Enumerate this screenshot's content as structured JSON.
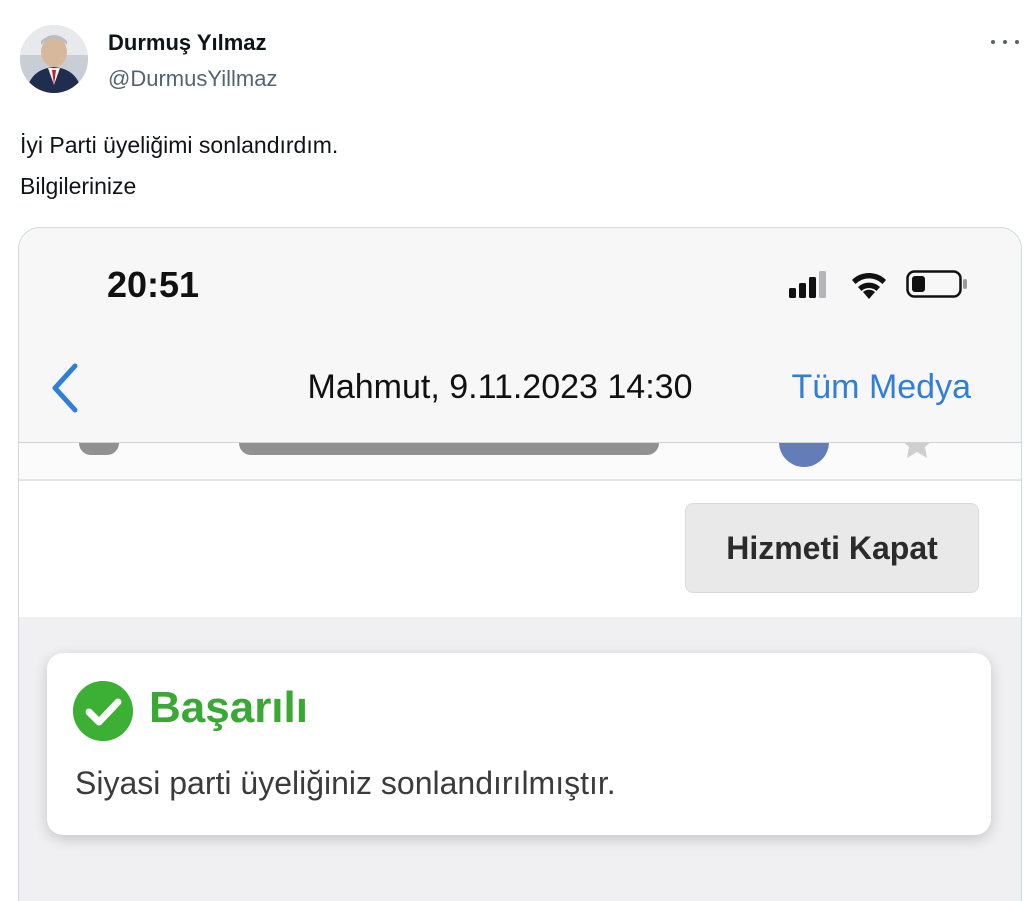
{
  "author": {
    "name": "Durmuş Yılmaz",
    "handle": "@DurmusYillmaz",
    "avatar_icon": "profile-photo"
  },
  "tweet": {
    "lines": [
      "İyi Parti üyeliğimi sonlandırdım.",
      "Bilgilerinize"
    ]
  },
  "media": {
    "status_bar": {
      "time": "20:51"
    },
    "nav": {
      "back_icon": "chevron-left-icon",
      "title": "Mahmut, 9.11.2023 14:30",
      "right_label": "Tüm Medya"
    },
    "close_service_label": "Hizmeti Kapat",
    "alert": {
      "title": "Başarılı",
      "message": "Siyasi parti üyeliğiniz sonlandırılmıştır."
    }
  },
  "colors": {
    "ios_blue": "#2f7fd9",
    "success_green": "#3aa835",
    "handle_gray": "#536471"
  }
}
